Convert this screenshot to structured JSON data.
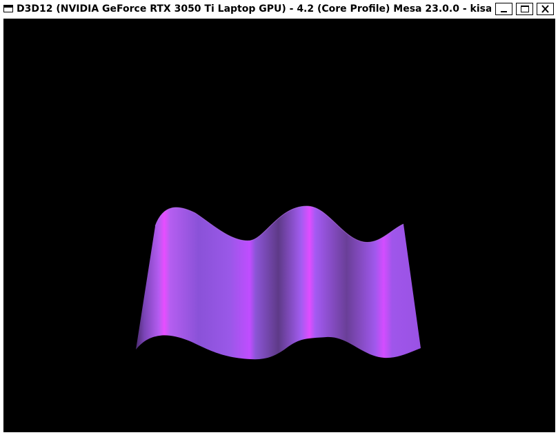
{
  "window": {
    "title": "D3D12 (NVIDIA GeForce RTX 3050 Ti Laptop GPU) - 4.2 (Core Profile) Mesa 23.0.0 - kisa...",
    "icon": "window-icon",
    "buttons": {
      "minimize_icon": "minimize-icon",
      "maximize_icon": "maximize-icon",
      "close_icon": "close-icon"
    }
  },
  "scene": {
    "background": "#000000",
    "surface_color": "#9b4de0",
    "highlight_color": "#e24dff",
    "shadow_color": "#5a2f85"
  }
}
